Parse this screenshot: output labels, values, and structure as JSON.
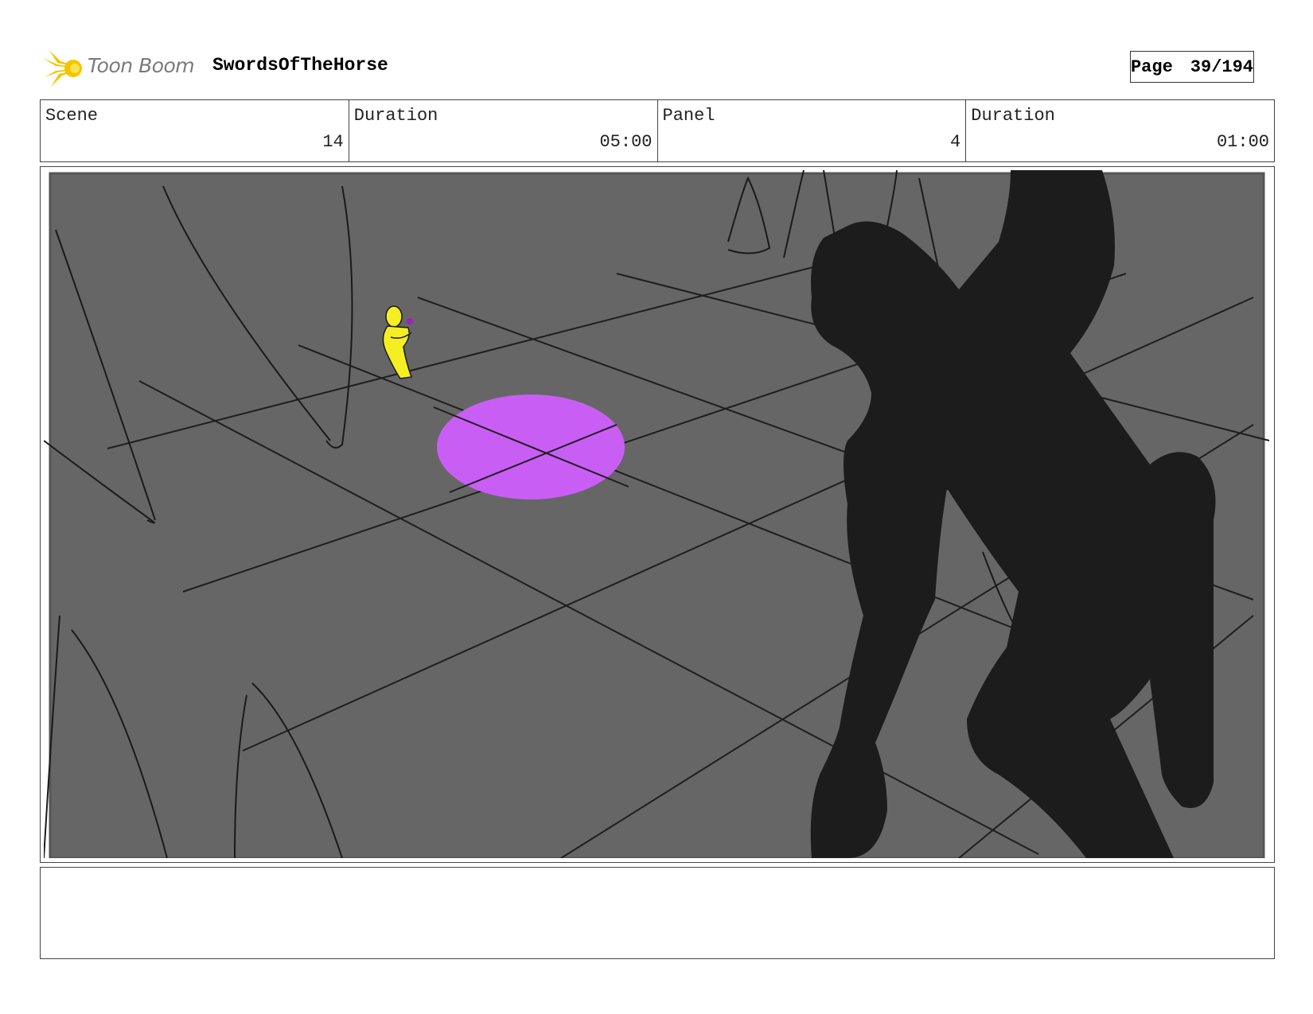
{
  "header": {
    "logo_text": "Toon Boom",
    "project_title": "SwordsOfTheHorse",
    "page_label": "Page",
    "page_number": "39/194"
  },
  "info": {
    "scene_label": "Scene",
    "scene_value": "14",
    "scene_duration_label": "Duration",
    "scene_duration_value": "05:00",
    "panel_label": "Panel",
    "panel_value": "4",
    "panel_duration_label": "Duration",
    "panel_duration_value": "01:00"
  },
  "colors": {
    "panel_background": "#666666",
    "silhouette": "#1c1c1c",
    "spotlight": "#c95ef5",
    "figure": "#f5ee22",
    "logo_burst": "#f5c400"
  },
  "notes": {
    "text": ""
  }
}
